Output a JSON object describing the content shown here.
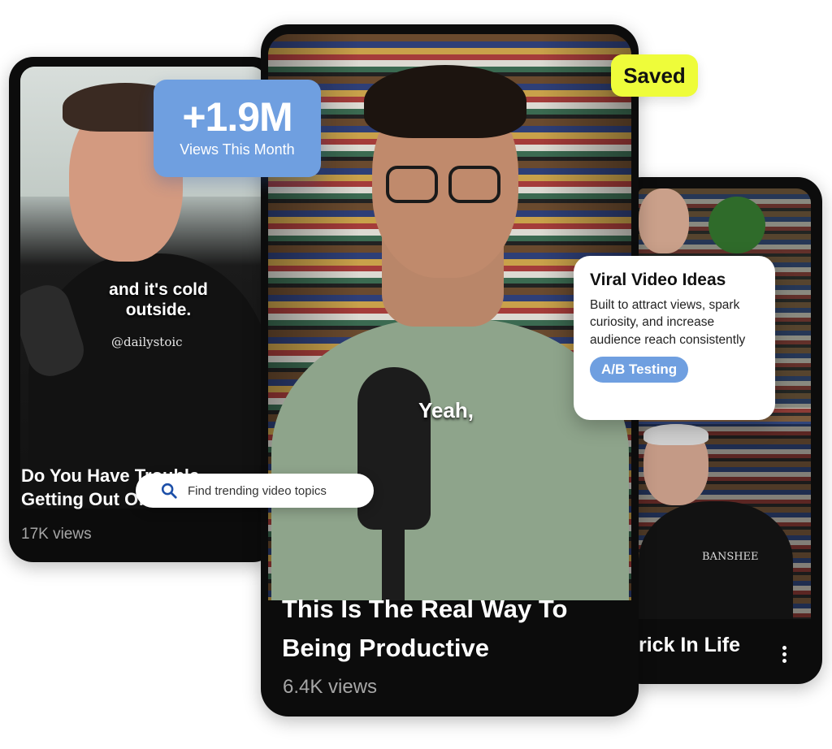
{
  "left_card": {
    "caption_line1": "and it's cold",
    "caption_line2": "outside.",
    "watermark": "@dailystoic",
    "title_line1": "Do You Have Trouble",
    "title_line2": "Getting Out Of Bed?",
    "views": "17K views"
  },
  "center_card": {
    "caption": "Yeah,",
    "title_line1": "This Is The Real Way To",
    "title_line2": "Being Productive",
    "views": "6.4K views"
  },
  "right_card": {
    "shirt_text": "BANSHEE",
    "title": "rick In Life"
  },
  "views_badge": {
    "value": "+1.9M",
    "label": "Views This Month"
  },
  "saved_badge": {
    "label": "Saved"
  },
  "search": {
    "placeholder": "Find trending video topics"
  },
  "ideas_card": {
    "heading": "Viral Video Ideas",
    "body": "Built to attract views, spark curiosity, and increase audience reach consistently",
    "tag": "A/B Testing"
  },
  "icons": {
    "search": "search-icon",
    "more": "more-vertical-icon"
  },
  "colors": {
    "accent_blue": "#6f9fe0",
    "saved_yellow": "#eefc3a",
    "card_bg": "#0c0c0c"
  }
}
